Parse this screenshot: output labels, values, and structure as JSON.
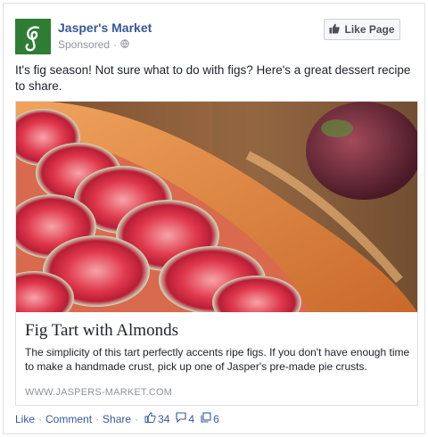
{
  "post": {
    "page_name": "Jasper's Market",
    "sponsored_label": "Sponsored",
    "dot": "·",
    "like_page_label": "Like Page",
    "text": "It's fig season! Not sure what to do with figs? Here's a great dessert recipe to share."
  },
  "attachment": {
    "title": "Fig Tart with Almonds",
    "description": "The simplicity of this tart perfectly accents ripe figs. If you don't have enough time to make a handmade crust, pick up one of Jasper's pre-made pie crusts.",
    "domain": "WWW.JASPERS-MARKET.COM"
  },
  "actions": {
    "like_label": "Like",
    "comment_label": "Comment",
    "share_label": "Share",
    "separator": "·",
    "likes_count": "34",
    "comments_count": "4",
    "shares_count": "6"
  },
  "icons": {
    "logo": "jaspers-market-logo",
    "globe": "globe-icon",
    "thumb": "thumbs-up-icon",
    "comment": "comment-icon",
    "share": "share-icon"
  },
  "colors": {
    "link_blue": "#365899",
    "logo_green": "#2e7d32",
    "meta_gray": "#90949c"
  }
}
